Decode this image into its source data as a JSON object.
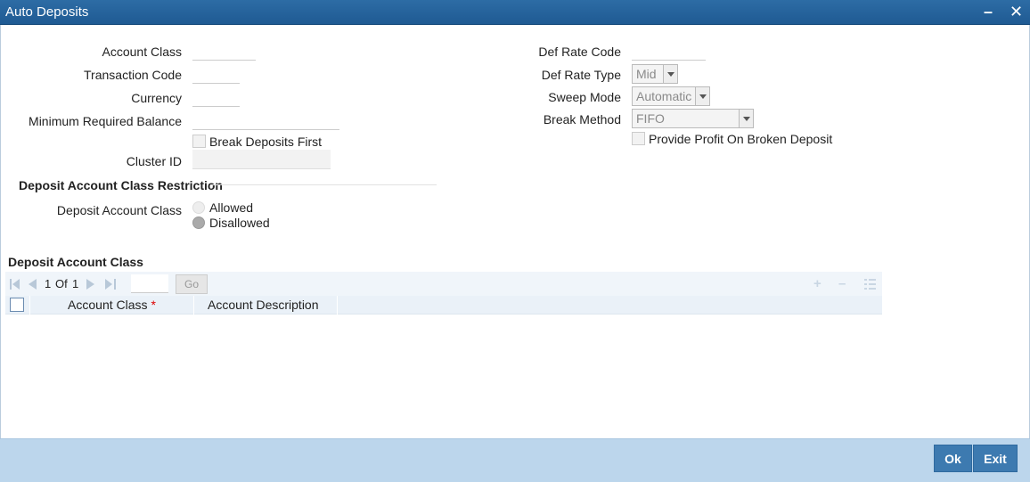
{
  "window": {
    "title": "Auto Deposits",
    "min_symbol": "–",
    "close_symbol": "✕"
  },
  "left_fields": {
    "account_class_label": "Account Class",
    "transaction_code_label": "Transaction Code",
    "currency_label": "Currency",
    "min_balance_label": "Minimum Required Balance",
    "break_deposits_label": "Break Deposits First",
    "cluster_id_label": "Cluster ID"
  },
  "right_fields": {
    "def_rate_code_label": "Def Rate Code",
    "def_rate_type_label": "Def Rate Type",
    "def_rate_type_value": "Mid",
    "sweep_mode_label": "Sweep Mode",
    "sweep_mode_value": "Automatic",
    "break_method_label": "Break Method",
    "break_method_value": "FIFO",
    "provide_profit_label": "Provide Profit On Broken Deposit"
  },
  "restriction": {
    "section_title": "Deposit Account Class Restriction",
    "field_label": "Deposit Account Class",
    "options": [
      "Allowed",
      "Disallowed"
    ],
    "selected": "Disallowed"
  },
  "grid": {
    "section_title": "Deposit Account Class",
    "page_current": "1",
    "page_of": "Of",
    "page_total": "1",
    "go_label": "Go",
    "columns": [
      "Account Class",
      "Account Description"
    ],
    "required_marker": "*",
    "rows": []
  },
  "footer": {
    "ok_label": "Ok",
    "exit_label": "Exit"
  },
  "colors": {
    "titlebar": "#2d6ca5",
    "footer": "#bcd6ec",
    "button": "#3d7ab0"
  }
}
